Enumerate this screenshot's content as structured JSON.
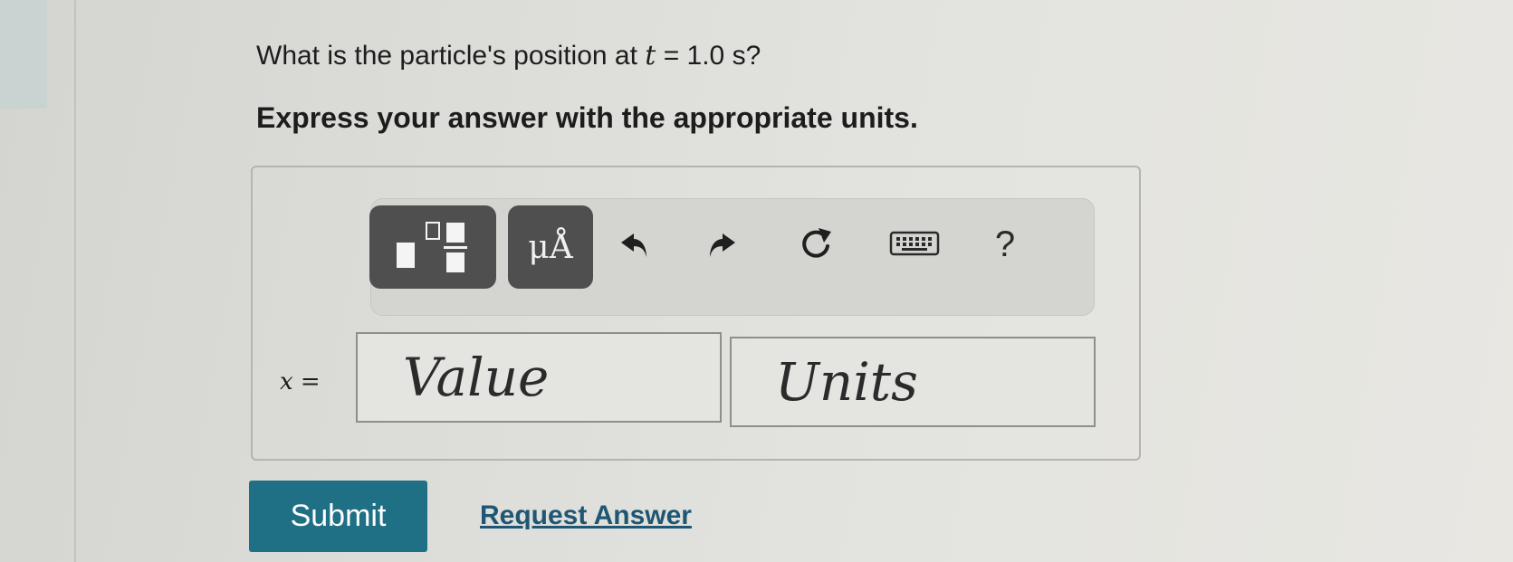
{
  "question": {
    "prefix": "What is the particle's position at",
    "variable": "t",
    "suffix": "= 1.0 s?"
  },
  "instruction": "Express your answer with the appropriate units.",
  "toolbar": {
    "units_label": "μÅ",
    "help_label": "?",
    "icons": [
      "templates-icon",
      "units-icon",
      "undo-icon",
      "redo-icon",
      "reset-icon",
      "keyboard-icon",
      "help-icon"
    ]
  },
  "answer": {
    "label": "x =",
    "value_placeholder": "Value",
    "units_placeholder": "Units"
  },
  "actions": {
    "submit_label": "Submit",
    "request_answer_label": "Request Answer"
  },
  "colors": {
    "submit_bg": "#1f6f85",
    "link": "#1f5673",
    "toolbar_dark": "#4f4f4f"
  }
}
